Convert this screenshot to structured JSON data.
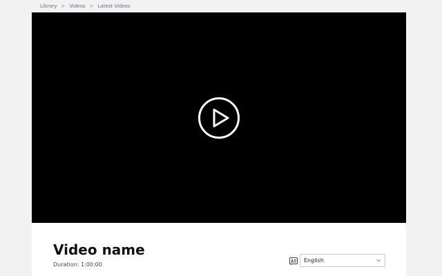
{
  "breadcrumb": {
    "items": [
      "Library",
      "Videos",
      "Latest Videos"
    ],
    "separator": ">"
  },
  "player": {
    "play_icon": "play-circle-icon"
  },
  "video": {
    "title": "Video name",
    "duration": "Duration: 1:00:00"
  },
  "language": {
    "icon": "translate-icon",
    "selected": "English"
  }
}
